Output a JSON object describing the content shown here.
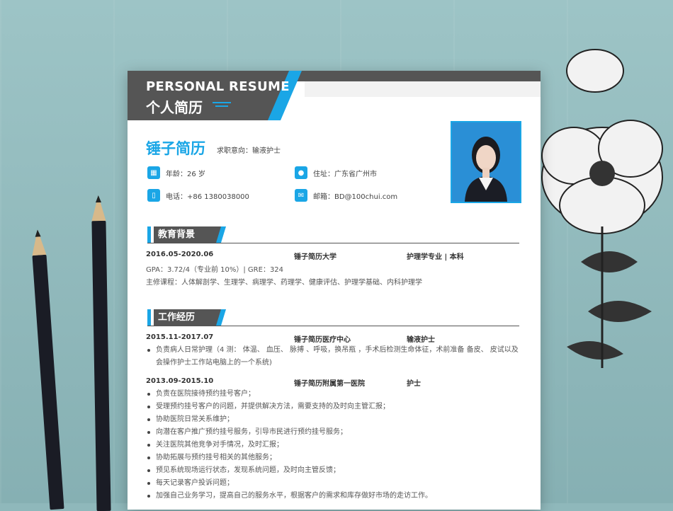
{
  "header": {
    "title_en": "PERSONAL RESUME",
    "title_cn": "个人简历"
  },
  "profile": {
    "name": "锤子简历",
    "intent": "求职意向：输液护士",
    "age": "年龄：26 岁",
    "address": "住址：广东省广州市",
    "phone": "电话：+86 1380038000",
    "email": "邮箱：BD@100chui.com"
  },
  "education": {
    "title": "教育背景",
    "period": "2016.05-2020.06",
    "school": "锤子简历大学",
    "major": "护理学专业 | 本科",
    "gpa": "GPA：3.72/4（专业前 10%）| GRE：324",
    "courses": "主修课程：人体解剖学、生理学、病理学、药理学、健康评估、护理学基础、内科护理学"
  },
  "work": {
    "title": "工作经历",
    "jobs": [
      {
        "period": "2015.11-2017.07",
        "company": "锤子简历医疗中心",
        "position": "输液护士",
        "items": [
          "负责病人日常护理（4 测： 体温、 血压、 脉搏 、呼吸，换吊瓶 ，手术后检测生命体征，术前准备 备皮、 皮试以及会操作护士工作站电脑上的一个系统)"
        ]
      },
      {
        "period": "2013.09-2015.10",
        "company": "锤子简历附属第一医院",
        "position": "护士",
        "items": [
          "负责在医院接待预约挂号客户；",
          "受理预约挂号客户的问题，并提供解决方法，需要支持的及时向主管汇报；",
          "协助医院日常关系维护；",
          "向潜在客户推广预约挂号服务，引导市民进行预约挂号服务；",
          "关注医院其他竞争对手情况，及时汇报；",
          "协助拓展与预约挂号相关的其他服务；",
          "预见系统现场运行状态，发现系统问题，及时向主管反馈；",
          "每天记录客户投诉问题；",
          "加强自己业务学习，提高自己的服务水平，根据客户的需求和库存做好市场的走访工作。"
        ]
      }
    ]
  },
  "icons": [
    "calendar-icon",
    "location-icon",
    "phone-icon",
    "mail-icon"
  ],
  "colors": {
    "accent": "#1aa6e6",
    "dark": "#555555",
    "background": "#8fb8bb"
  }
}
